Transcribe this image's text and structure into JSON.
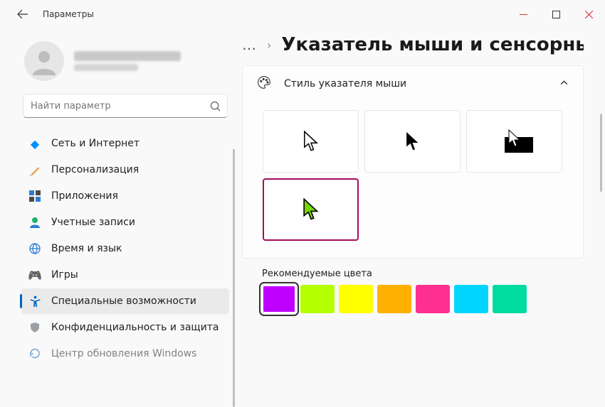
{
  "window": {
    "title": "Параметры"
  },
  "search": {
    "placeholder": "Найти параметр"
  },
  "nav": {
    "items": [
      {
        "label": "Сеть и Интернет"
      },
      {
        "label": "Персонализация"
      },
      {
        "label": "Приложения"
      },
      {
        "label": "Учетные записи"
      },
      {
        "label": "Время и язык"
      },
      {
        "label": "Игры"
      },
      {
        "label": "Специальные возможности"
      },
      {
        "label": "Конфиденциальность и защита"
      },
      {
        "label": "Центр обновления Windows"
      }
    ],
    "selected_index": 6
  },
  "breadcrumb": {
    "dots": "…",
    "sep": "›",
    "title": "Указатель мыши и сенсорный"
  },
  "panel": {
    "title": "Стиль указателя мыши"
  },
  "colors": {
    "label": "Рекомендуемые цвета",
    "list": [
      "#c000ff",
      "#b4ff00",
      "#ffff00",
      "#ffb000",
      "#ff2f92",
      "#00d5ff",
      "#00dca0"
    ],
    "selected_index": 0
  },
  "cursor_styles": {
    "selected_index": 3,
    "custom_cursor_color": "#76d600"
  }
}
